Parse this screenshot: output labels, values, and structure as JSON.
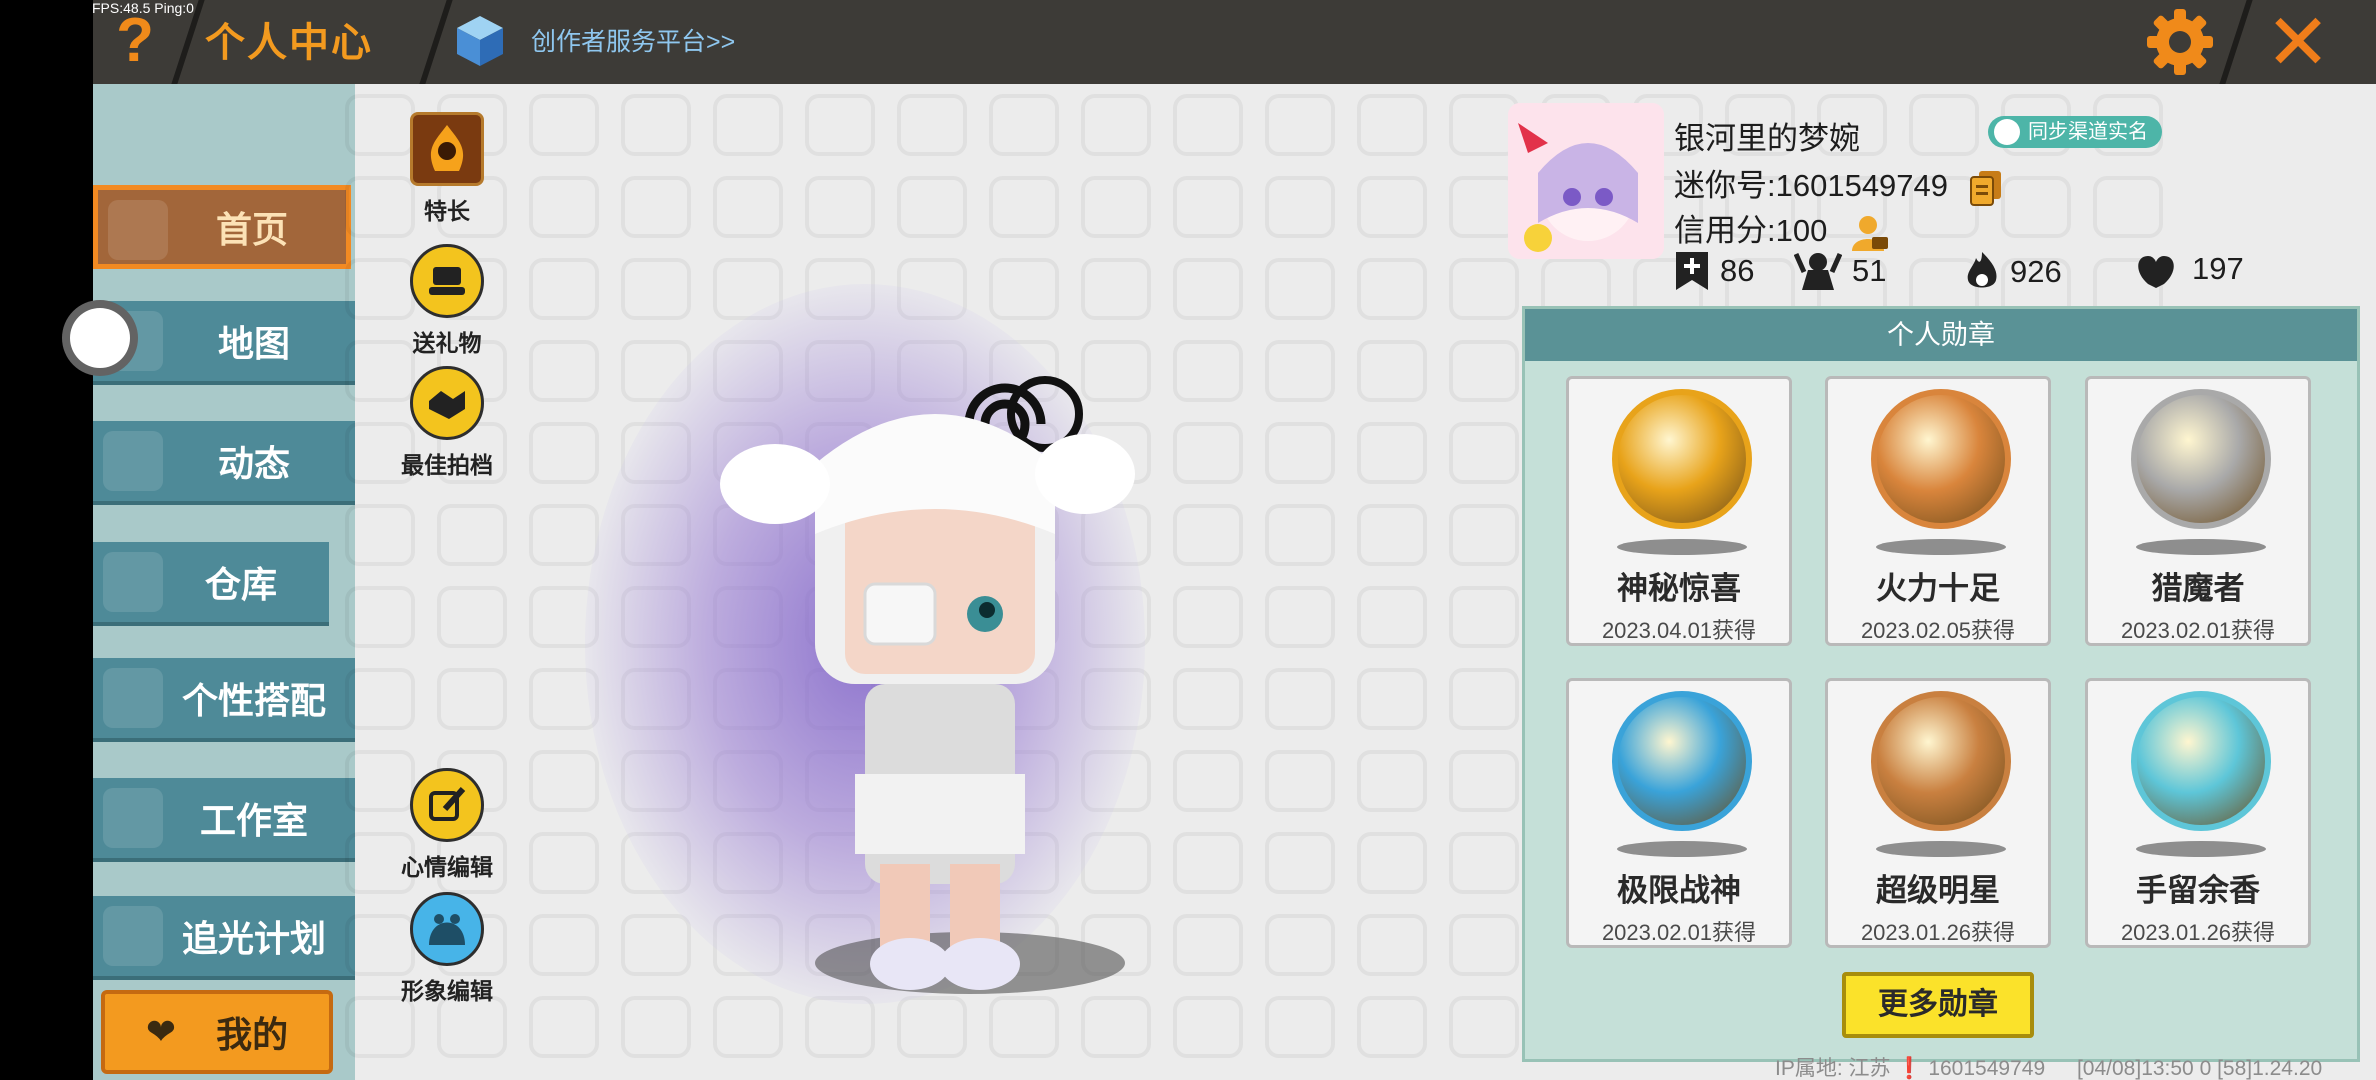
{
  "debug": {
    "fps": "FPS:48.5  Ping:0"
  },
  "topbar": {
    "help_symbol": "?",
    "title": "个人中心",
    "creator_link": "创作者服务平台>>",
    "close_symbol": "✕"
  },
  "nav": {
    "items": [
      {
        "label": "首页",
        "active": true
      },
      {
        "label": "地图"
      },
      {
        "label": "动态"
      },
      {
        "label": "仓库"
      },
      {
        "label": "个性搭配"
      },
      {
        "label": "工作室"
      },
      {
        "label": "追光计划"
      }
    ],
    "me_label": "我的"
  },
  "actions": {
    "specialty": "特长",
    "gift": "送礼物",
    "best_photo": "最佳拍档",
    "mood_edit": "心情编辑",
    "look_edit": "形象编辑"
  },
  "profile": {
    "name": "银河里的梦婉",
    "sync_badge": "同步渠道实名",
    "mini_id": "迷你号:1601549749",
    "credit": "信用分:100",
    "stats": {
      "bookmarks": "86",
      "fans": "51",
      "heat": "926",
      "likes": "197"
    }
  },
  "medals": {
    "title": "个人勋章",
    "items": [
      {
        "name": "神秘惊喜",
        "date": "2023.04.01获得",
        "color": "#e8a31a"
      },
      {
        "name": "火力十足",
        "date": "2023.02.05获得",
        "color": "#d9853c"
      },
      {
        "name": "猎魔者",
        "date": "2023.02.01获得",
        "color": "#a9a9a9"
      },
      {
        "name": "极限战神",
        "date": "2023.02.01获得",
        "color": "#3aa3d9"
      },
      {
        "name": "超级明星",
        "date": "2023.01.26获得",
        "color": "#c98040"
      },
      {
        "name": "手留余香",
        "date": "2023.01.26获得",
        "color": "#5ec6d8"
      }
    ],
    "more_button": "更多勋章"
  },
  "footer": {
    "ip": "IP属地: 江苏 ❗ 1601549749",
    "meta": "[04/08]13:50 0  [58]1.24.20"
  },
  "colors": {
    "accent": "#f39a1f",
    "nav_bg": "#4e8a98",
    "panel": "#c5e0d8"
  }
}
